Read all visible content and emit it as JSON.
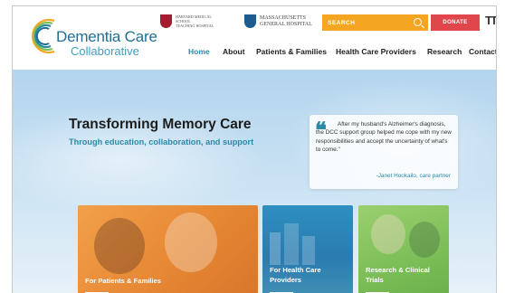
{
  "brand": {
    "name": "Dementia Care",
    "subtitle": "Collaborative",
    "ring_colors": [
      "#f4a623",
      "#7cc04d",
      "#2a8aa8",
      "#1f6f95"
    ]
  },
  "affiliations": {
    "harvard": "Harvard Medical School\nTeaching Hospital",
    "mgh": "Massachusetts\nGeneral Hospital"
  },
  "search": {
    "placeholder": "SEARCH",
    "icon": "search-icon"
  },
  "donate_label": "DONATE",
  "text_size_label": "TT",
  "nav": {
    "home": "Home",
    "about": "About",
    "patients": "Patients & Families",
    "providers": "Health Care Providers",
    "research": "Research",
    "contact": "Contact"
  },
  "hero": {
    "title": "Transforming Memory Care",
    "subtitle": "Through education, collaboration, and support"
  },
  "testimonial": {
    "quote": "After my husband's Alzheimer's diagnosis, the DCC support group helped me cope with my new responsibilities and accept the uncertainty of what's to come.\"",
    "author": "-Janet Hookailo, care partner"
  },
  "tiles": {
    "patients": "For Patients & Families",
    "providers": "For Health Care Providers",
    "research": "Research & Clinical Trials"
  },
  "colors": {
    "accent_teal": "#2a8aa8",
    "search_orange": "#f4a623",
    "donate_red": "#e0474c"
  }
}
